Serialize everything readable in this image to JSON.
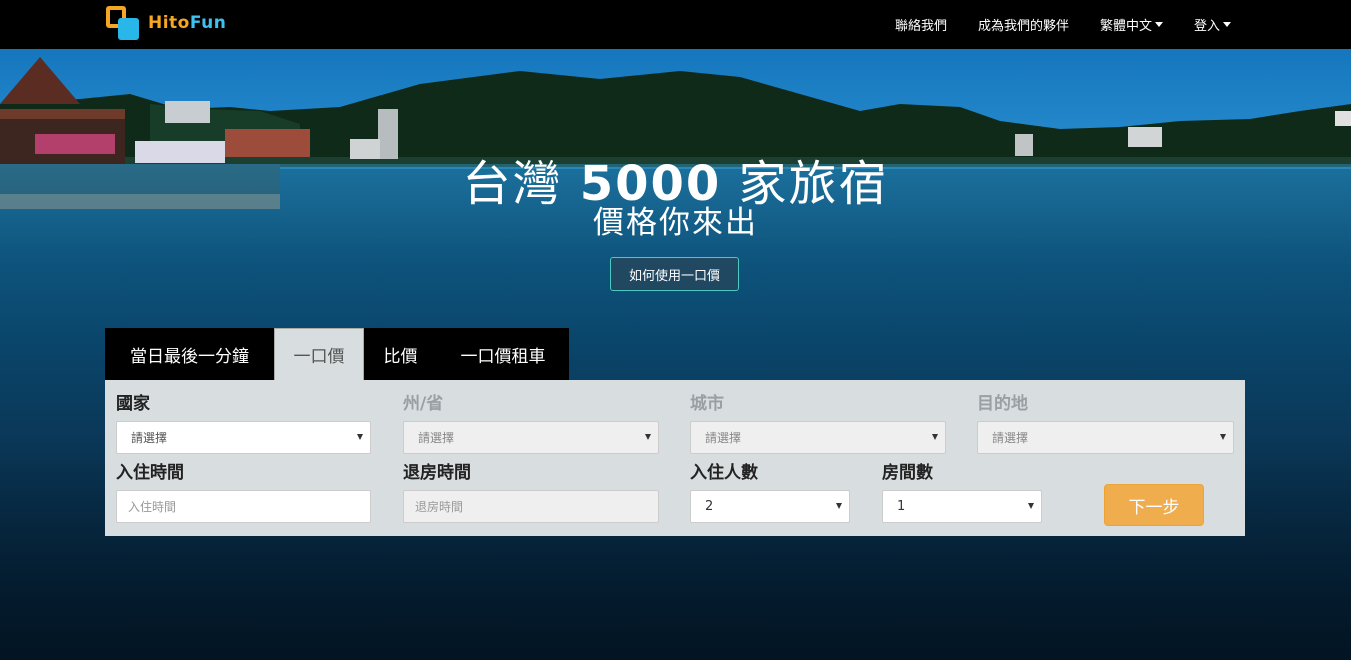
{
  "brand": {
    "logo_text_a": "Hito",
    "logo_text_b": "Fun"
  },
  "nav": {
    "contact": "聯絡我們",
    "partner": "成為我們的夥伴",
    "language": "繁體中文",
    "login": "登入"
  },
  "hero": {
    "headline_a": "台灣 ",
    "headline_num": "5000",
    "headline_b": " 家旅宿",
    "subheadline": "價格你來出",
    "how_button": "如何使用一口價"
  },
  "tabs": [
    {
      "label": "當日最後一分鐘"
    },
    {
      "label": "一口價"
    },
    {
      "label": "比價"
    },
    {
      "label": "一口價租車"
    }
  ],
  "form": {
    "country_label": "國家",
    "province_label": "州/省",
    "city_label": "城市",
    "destination_label": "目的地",
    "select_placeholder": "請選擇",
    "checkin_label": "入住時間",
    "checkout_label": "退房時間",
    "guests_label": "入住人數",
    "rooms_label": "房間數",
    "checkin_placeholder": "入住時間",
    "checkout_placeholder": "退房時間",
    "guests_value": "2",
    "rooms_value": "1",
    "next_button": "下一步"
  },
  "colors": {
    "navbar": "#000000",
    "accent_orange": "#f0ad4e",
    "logo_blue": "#29b6e8",
    "panel_bg": "#d8dde0"
  }
}
